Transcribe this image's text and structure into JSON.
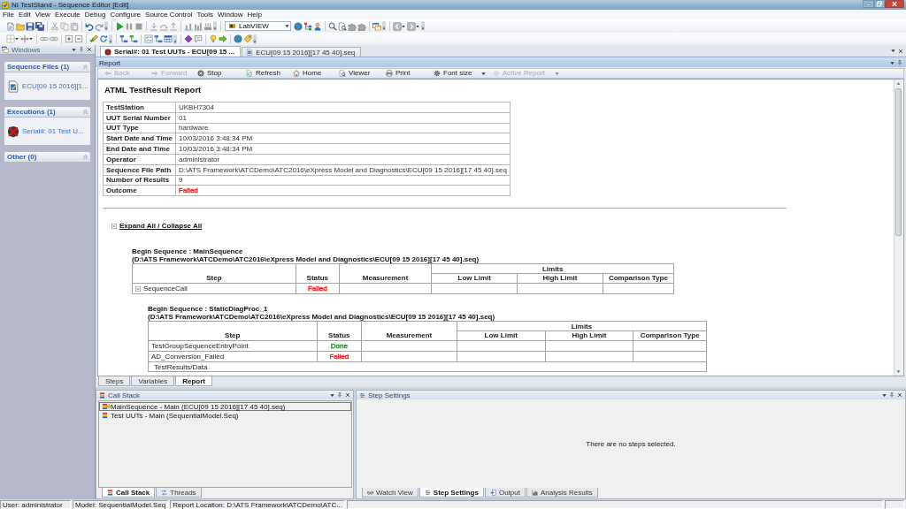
{
  "window": {
    "title": "NI TestStand - Sequence Editor [Edit]"
  },
  "menu": [
    "File",
    "Edit",
    "View",
    "Execute",
    "Debug",
    "Configure",
    "Source Control",
    "Tools",
    "Window",
    "Help"
  ],
  "toolbar": {
    "adapter": "LabVIEW"
  },
  "windows_pane": {
    "title": "Windows",
    "groups": [
      {
        "title": "Sequence Files (1)",
        "items": [
          {
            "label": "ECU[09 15 2016][1...",
            "kind": "sequence-file"
          }
        ]
      },
      {
        "title": "Executions (1)",
        "items": [
          {
            "label": "Serial#: 01 Test U...",
            "kind": "execution"
          }
        ]
      },
      {
        "title": "Other (0)"
      }
    ]
  },
  "document_tabs": [
    {
      "label": "Serial#: 01 Test UUTs - ECU[09 15 ...",
      "kind": "execution",
      "selected": true
    },
    {
      "label": "ECU[09 15 2016][17 45 40].seq",
      "kind": "sequence-file",
      "selected": false
    }
  ],
  "report_pane": {
    "title": "Report",
    "toolbar": [
      {
        "label": "Back",
        "kind": "back",
        "disabled": true
      },
      {
        "label": "Forward",
        "kind": "forward",
        "disabled": true
      },
      {
        "label": "Stop",
        "kind": "stop",
        "disabled": false
      },
      {
        "label": "Refresh",
        "kind": "refresh",
        "disabled": false
      },
      {
        "label": "Home",
        "kind": "home",
        "disabled": false
      },
      {
        "label": "Viewer",
        "kind": "viewer",
        "disabled": false
      },
      {
        "label": "Print",
        "kind": "print",
        "disabled": false
      },
      {
        "label": "Font size",
        "kind": "font-size",
        "disabled": false
      },
      {
        "label": "Active Report",
        "kind": "active-report",
        "disabled": true
      }
    ]
  },
  "report": {
    "title": "ATML TestResult Report",
    "info": [
      {
        "label": "TestStation",
        "value": "UKBH7304"
      },
      {
        "label": "UUT Serial Number",
        "value": "01"
      },
      {
        "label": "UUT Type",
        "value": "hardware"
      },
      {
        "label": "Start Date and Time",
        "value": "10/03/2016 3:48:34 PM"
      },
      {
        "label": "End Date and Time",
        "value": "10/03/2016 3:48:34 PM"
      },
      {
        "label": "Operator",
        "value": "administrator"
      },
      {
        "label": "Sequence File Path",
        "value": "D:\\ATS Framework\\ATCDemo\\ATC2016\\eXpress Model and Diagnostics\\ECU[09 15 2016][17 45 40].seq"
      },
      {
        "label": "Number of Results",
        "value": "9"
      },
      {
        "label": "Outcome",
        "value": "Failed",
        "color": "#ff2020"
      }
    ],
    "expand_all": "Expand All / Collapse All",
    "sequences": [
      {
        "heading": "Begin Sequence : MainSequence",
        "path": "(D:\\ATS Framework\\ATCDemo\\ATC2016\\eXpress Model and Diagnostics\\ECU[09 15 2016][17 45 40].seq)",
        "columns": [
          "Step",
          "Status",
          "Measurement"
        ],
        "limits": {
          "label": "Limits",
          "columns": [
            "Low Limit",
            "High Limit",
            "Comparison Type"
          ]
        },
        "rows": [
          {
            "kind": "call",
            "step": "SequenceCall",
            "status": "Failed",
            "color": "#ff2020",
            "expanded": true,
            "children": [
              {
                "heading": "Begin Sequence : StaticDiagProc_1",
                "path": "(D:\\ATS Framework\\ATCDemo\\ATC2016\\eXpress Model and Diagnostics\\ECU[09 15 2016][17 45 40].seq)",
                "columns": [
                  "Step",
                  "Status",
                  "Measurement"
                ],
                "limits": {
                  "label": "Limits",
                  "columns": [
                    "Low Limit",
                    "High Limit",
                    "Comparison Type"
                  ]
                },
                "rows": [
                  {
                    "kind": "step",
                    "step": "TestGroupSequenceEntryPoint",
                    "status": "Done",
                    "color": "#1e9a2e"
                  },
                  {
                    "kind": "step",
                    "step": "AD_Conversion_Failed",
                    "status": "Failed",
                    "color": "#ff2020"
                  },
                  {
                    "kind": "data",
                    "step": "TestResults/Data"
                  }
                ]
              }
            ]
          }
        ]
      }
    ]
  },
  "view_tabs": [
    {
      "label": "Steps",
      "selected": false
    },
    {
      "label": "Variables",
      "selected": false
    },
    {
      "label": "Report",
      "selected": true
    }
  ],
  "call_stack": {
    "title": "Call Stack",
    "items": [
      {
        "label": "MainSequence - Main (ECU[09 15 2016][17 45 40].seq)",
        "selected": true,
        "current": true
      },
      {
        "label": "Test UUTs - Main (SequentialModel.Seq)",
        "selected": false,
        "current": false
      }
    ],
    "tabs": [
      {
        "label": "Call Stack",
        "kind": "call-stack",
        "selected": true
      },
      {
        "label": "Threads",
        "kind": "threads",
        "selected": false
      }
    ]
  },
  "step_settings": {
    "title": "Step Settings",
    "message": "There are no steps selected.",
    "tabs": [
      {
        "label": "Watch View",
        "kind": "watch",
        "selected": false
      },
      {
        "label": "Step Settings",
        "kind": "step-settings",
        "selected": true
      },
      {
        "label": "Output",
        "kind": "output",
        "selected": false
      },
      {
        "label": "Analysis Results",
        "kind": "analysis",
        "selected": false
      }
    ]
  },
  "status_bar": [
    "User: administrator",
    "Model: SequentialModel.Seq",
    "Report Location: D:\\ATS Framework\\ATCDemo\\ATC..."
  ]
}
